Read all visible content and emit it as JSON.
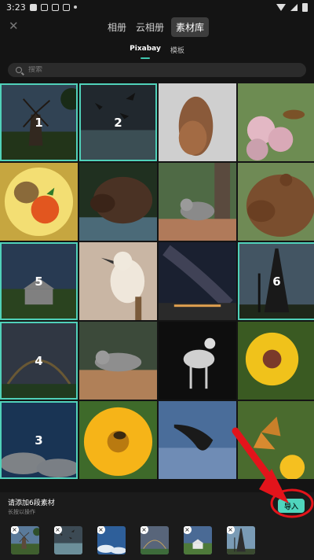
{
  "status_bar": {
    "time": "3:23"
  },
  "top_bar": {
    "tabs": [
      "相册",
      "云相册",
      "素材库"
    ],
    "active_tab": "素材库"
  },
  "sub_tabs": [
    "Pixabay",
    "模板"
  ],
  "search": {
    "placeholder": "搜索"
  },
  "grid": {
    "items": [
      {
        "name": "windmill",
        "selected": true,
        "order": "1"
      },
      {
        "name": "birds",
        "selected": true,
        "order": "2"
      },
      {
        "name": "squirrel-climbing",
        "selected": false,
        "order": ""
      },
      {
        "name": "bee-on-flowers",
        "selected": false,
        "order": ""
      },
      {
        "name": "fruit-plate",
        "selected": false,
        "order": ""
      },
      {
        "name": "bear-water",
        "selected": false,
        "order": ""
      },
      {
        "name": "squirrel-tree",
        "selected": false,
        "order": ""
      },
      {
        "name": "brown-bear",
        "selected": false,
        "order": ""
      },
      {
        "name": "house-field",
        "selected": true,
        "order": "5"
      },
      {
        "name": "kookaburra",
        "selected": false,
        "order": ""
      },
      {
        "name": "milky-way",
        "selected": false,
        "order": ""
      },
      {
        "name": "eiffel-tower",
        "selected": true,
        "order": "6"
      },
      {
        "name": "rainbow-field",
        "selected": true,
        "order": "4"
      },
      {
        "name": "squirrel-fence",
        "selected": false,
        "order": ""
      },
      {
        "name": "fawn",
        "selected": false,
        "order": ""
      },
      {
        "name": "yellow-daisy",
        "selected": false,
        "order": ""
      },
      {
        "name": "sky-clouds",
        "selected": true,
        "order": "3"
      },
      {
        "name": "bee-flower",
        "selected": false,
        "order": ""
      },
      {
        "name": "cormorant",
        "selected": false,
        "order": ""
      },
      {
        "name": "butterfly",
        "selected": false,
        "order": ""
      }
    ]
  },
  "bottom": {
    "hint": "请添加6段素材",
    "sub_hint": "长按以操作",
    "import_label": "导入",
    "thumbs": [
      "windmill",
      "birds",
      "sky-clouds",
      "rainbow-field",
      "house-field",
      "eiffel-tower"
    ]
  },
  "colors": {
    "accent": "#4fd5bd",
    "annotation": "#e3141b"
  }
}
